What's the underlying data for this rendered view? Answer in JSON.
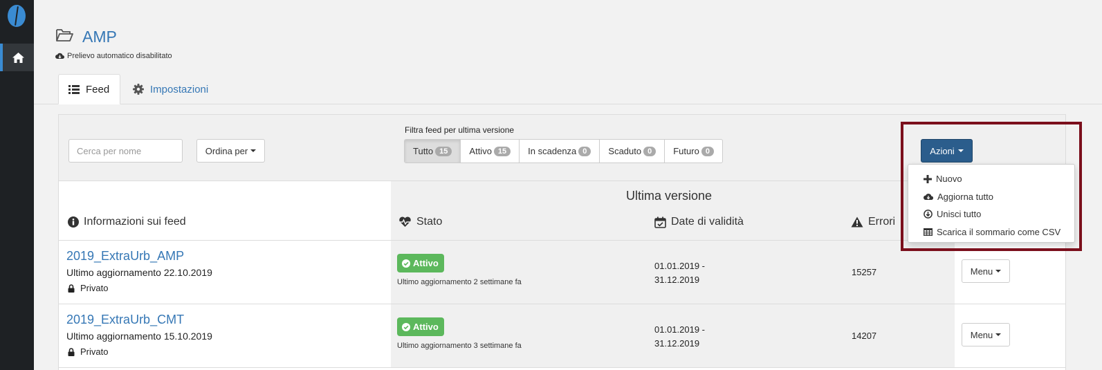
{
  "header": {
    "title": "AMP",
    "subtitle": "Prelievo automatico disabilitato"
  },
  "tabs": [
    {
      "label": "Feed",
      "icon": "list-icon",
      "active": true
    },
    {
      "label": "Impostazioni",
      "icon": "gear-icon",
      "active": false
    }
  ],
  "toolbar": {
    "search_placeholder": "Cerca per nome",
    "sort_label": "Ordina per",
    "filter_label": "Filtra feed per ultima versione",
    "filters": [
      {
        "label": "Tutto",
        "count": "15",
        "active": true
      },
      {
        "label": "Attivo",
        "count": "15",
        "active": false
      },
      {
        "label": "In scadenza",
        "count": "0",
        "active": false
      },
      {
        "label": "Scaduto",
        "count": "0",
        "active": false
      },
      {
        "label": "Futuro",
        "count": "0",
        "active": false
      }
    ],
    "actions_label": "Azioni"
  },
  "actions_menu": [
    {
      "label": "Nuovo",
      "icon": "plus-icon"
    },
    {
      "label": "Aggiorna tutto",
      "icon": "cloud-download-icon"
    },
    {
      "label": "Unisci tutto",
      "icon": "download-circle-icon"
    },
    {
      "label": "Scarica il sommario come CSV",
      "icon": "table-icon"
    }
  ],
  "table": {
    "group_header": "Ultima versione",
    "columns": {
      "info": "Informazioni sui feed",
      "status": "Stato",
      "validity": "Date di validità",
      "errors": "Errori"
    },
    "rows": [
      {
        "name": "2019_ExtraUrb_AMP",
        "updated": "Ultimo aggiornamento 22.10.2019",
        "visibility": "Privato",
        "status": "Attivo",
        "status_sub": "Ultimo aggiornamento 2 settimane fa",
        "validity_start": "01.01.2019 -",
        "validity_end": "31.12.2019",
        "errors": "15257",
        "menu_label": "Menu"
      },
      {
        "name": "2019_ExtraUrb_CMT",
        "updated": "Ultimo aggiornamento 15.10.2019",
        "visibility": "Privato",
        "status": "Attivo",
        "status_sub": "Ultimo aggiornamento 3 settimane fa",
        "validity_start": "01.01.2019 -",
        "validity_end": "31.12.2019",
        "errors": "14207",
        "menu_label": "Menu"
      }
    ]
  },
  "colors": {
    "accent": "#3577b5",
    "status_active": "#5cb85c",
    "highlight_border": "#7b0f1c",
    "sidebar": "#1e2124"
  }
}
